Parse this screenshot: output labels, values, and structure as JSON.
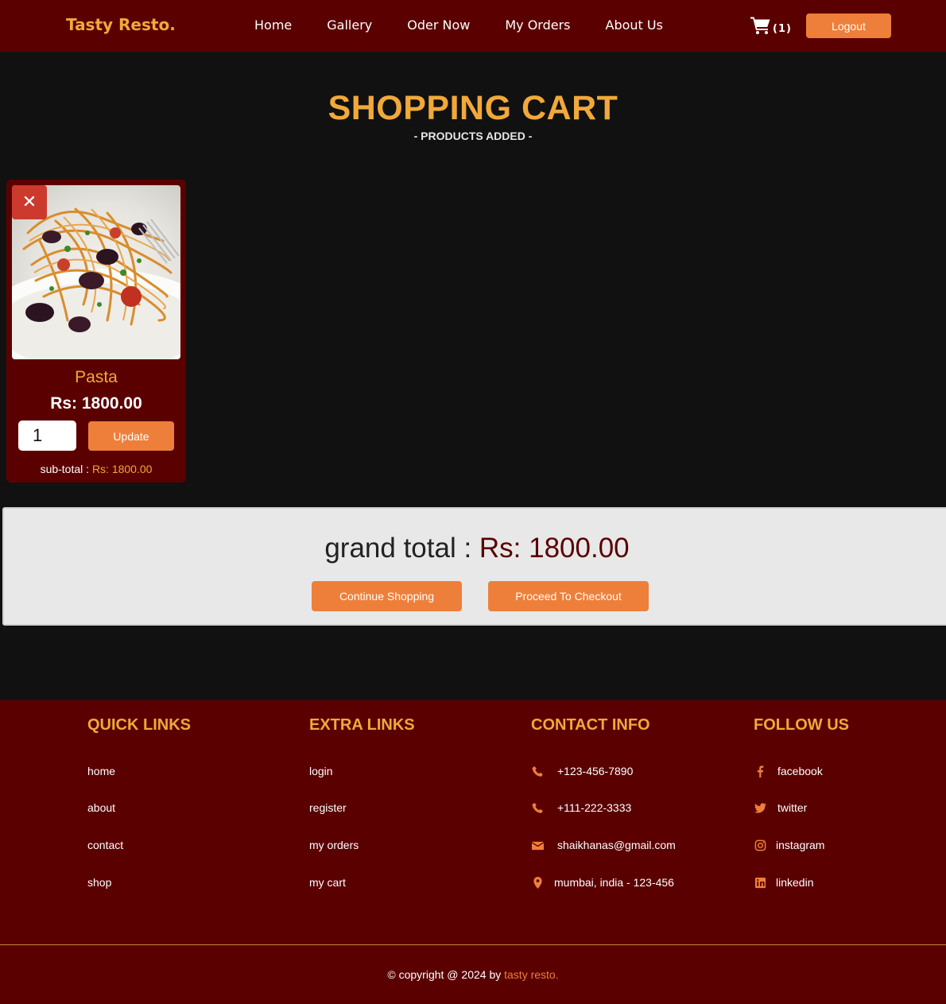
{
  "header": {
    "brand": "Tasty Resto.",
    "nav": [
      "Home",
      "Gallery",
      "Oder Now",
      "My Orders",
      "About Us"
    ],
    "cart_count": "(1)",
    "logout_label": "Logout"
  },
  "page": {
    "title": "SHOPPING CART",
    "subtitle": "- PRODUCTS ADDED -"
  },
  "cart_items": [
    {
      "remove_label": "✕",
      "name": "Pasta",
      "price": "Rs: 1800.00",
      "quantity": "1",
      "update_label": "Update",
      "subtotal_label": "sub-total :",
      "subtotal_value": "Rs: 1800.00"
    }
  ],
  "totals": {
    "grand_label": "grand total :",
    "grand_value": "Rs: 1800.00",
    "continue_label": "Continue Shopping",
    "checkout_label": "Proceed To Checkout"
  },
  "footer": {
    "quick_links": {
      "title": "QUICK LINKS",
      "items": [
        "home",
        "about",
        "contact",
        "shop"
      ]
    },
    "extra_links": {
      "title": "EXTRA LINKS",
      "items": [
        "login",
        "register",
        "my orders",
        "my cart"
      ]
    },
    "contact_info": {
      "title": "CONTACT INFO",
      "items": [
        {
          "icon": "phone-icon",
          "text": "+123-456-7890"
        },
        {
          "icon": "phone-icon",
          "text": "+111-222-3333"
        },
        {
          "icon": "envelope-icon",
          "text": "shaikhanas@gmail.com"
        },
        {
          "icon": "map-pin-icon",
          "text": "mumbai, india - 123-456"
        }
      ]
    },
    "follow_us": {
      "title": "FOLLOW US",
      "items": [
        {
          "icon": "facebook-icon",
          "text": "facebook"
        },
        {
          "icon": "twitter-icon",
          "text": "twitter"
        },
        {
          "icon": "instagram-icon",
          "text": "instagram"
        },
        {
          "icon": "linkedin-icon",
          "text": "linkedin"
        }
      ]
    },
    "copyright_prefix": "© copyright @ 2024 by",
    "copyright_brand": "tasty resto."
  },
  "colors": {
    "header_bg": "#5a0000",
    "accent": "#f0a93a",
    "button": "#ee7f3a",
    "page_bg": "#111111",
    "remove_bg": "#cc3a2e"
  }
}
